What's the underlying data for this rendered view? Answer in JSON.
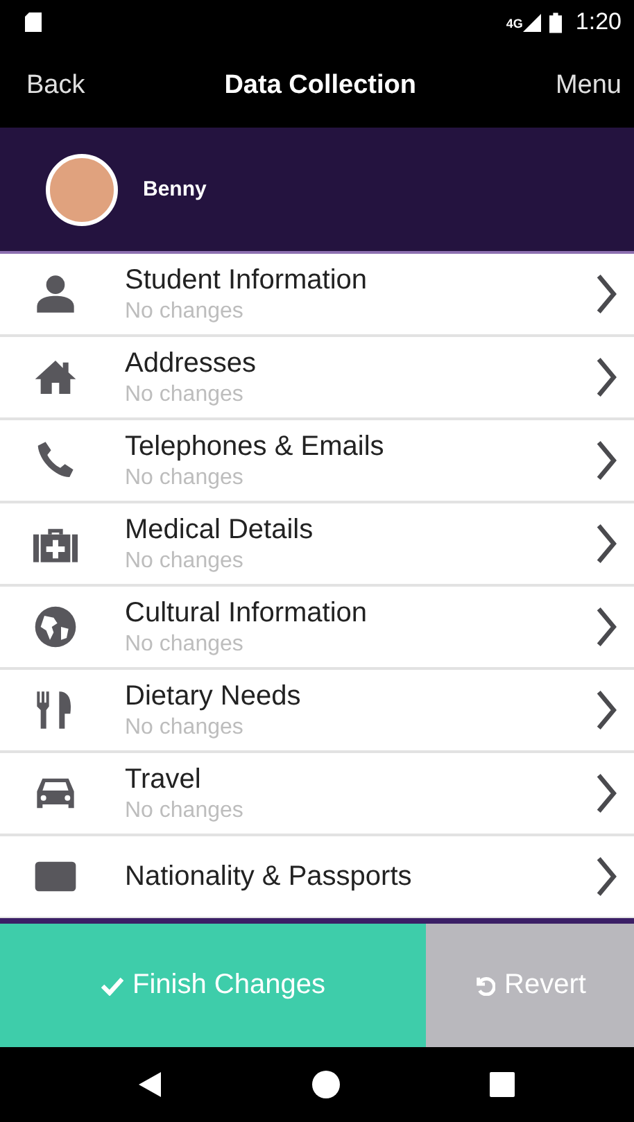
{
  "status_bar": {
    "time": "1:20",
    "network": "4G"
  },
  "nav": {
    "back": "Back",
    "title": "Data Collection",
    "menu": "Menu"
  },
  "profile": {
    "name": "Benny"
  },
  "sections": [
    {
      "kind": "person",
      "title": "Student Information",
      "subtitle": "No changes"
    },
    {
      "kind": "house",
      "title": "Addresses",
      "subtitle": "No changes"
    },
    {
      "kind": "phone",
      "title": "Telephones & Emails",
      "subtitle": "No changes"
    },
    {
      "kind": "medkit",
      "title": "Medical Details",
      "subtitle": "No changes"
    },
    {
      "kind": "globe",
      "title": "Cultural Information",
      "subtitle": "No changes"
    },
    {
      "kind": "cutlery",
      "title": "Dietary Needs",
      "subtitle": "No changes"
    },
    {
      "kind": "car",
      "title": "Travel",
      "subtitle": "No changes"
    },
    {
      "kind": "card",
      "title": "Nationality & Passports"
    }
  ],
  "actions": [
    {
      "kind": "finish",
      "label": "Finish Changes"
    },
    {
      "kind": "revert",
      "label": "Revert"
    }
  ]
}
